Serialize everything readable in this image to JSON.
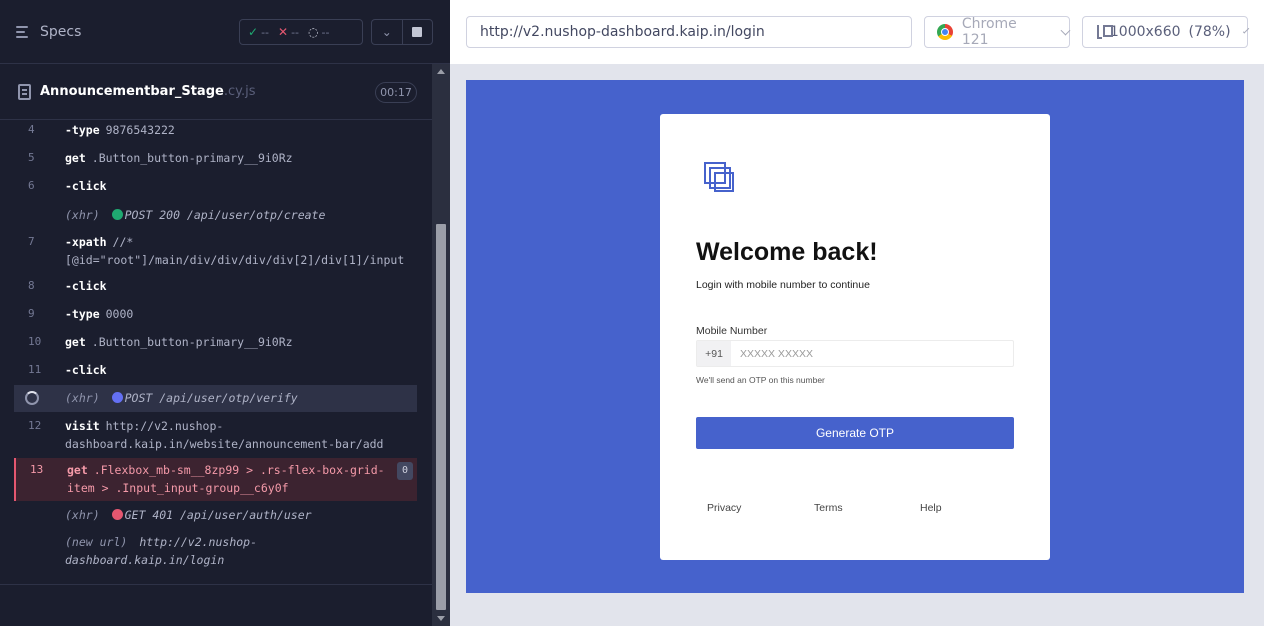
{
  "runner": {
    "specs_label": "Specs",
    "stats": {
      "passed": "--",
      "failed": "--",
      "pending": "--"
    },
    "spec_name": "Announcementbar_Stage",
    "spec_ext": ".cy.js",
    "duration": "00:17"
  },
  "commands": [
    {
      "num": "4",
      "name": "-type",
      "arg": "9876543222"
    },
    {
      "num": "5",
      "name": "get",
      "arg": ".Button_button-primary__9i0Rz"
    },
    {
      "num": "6",
      "name": "-click",
      "arg": ""
    },
    {
      "num": "",
      "xhr": "(xhr)",
      "status_color": "#1fa971",
      "req": "POST 200 /api/user/otp/create"
    },
    {
      "num": "7",
      "name": "-xpath",
      "arg": "//*[@id=\"root\"]/main/div/div/div/div[2]/div[1]/input"
    },
    {
      "num": "8",
      "name": "-click",
      "arg": ""
    },
    {
      "num": "9",
      "name": "-type",
      "arg": "0000"
    },
    {
      "num": "10",
      "name": "get",
      "arg": ".Button_button-primary__9i0Rz"
    },
    {
      "num": "11",
      "name": "-click",
      "arg": ""
    },
    {
      "num": "",
      "xhr": "(xhr)",
      "status_color": "#6470f3",
      "req": "POST /api/user/otp/verify"
    },
    {
      "num": "12",
      "name": "visit",
      "arg": "http://v2.nushop-dashboard.kaip.in/website/announcement-bar/add"
    },
    {
      "num": "13",
      "name": "get",
      "arg": ".Flexbox_mb-sm__8zp99 > .rs-flex-box-grid-item > .Input_input-group__c6y0f",
      "badge": "0"
    },
    {
      "num": "",
      "xhr": "(xhr)",
      "status_color": "#e45770",
      "req": "GET 401 /api/user/auth/user"
    },
    {
      "num": "",
      "xhr": "(new url)",
      "req": "http://v2.nushop-dashboard.kaip.in/login"
    }
  ],
  "browser_bar": {
    "url": "http://v2.nushop-dashboard.kaip.in/login",
    "browser": "Chrome 121",
    "viewport": "1000x660",
    "scale": "(78%)"
  },
  "login": {
    "title": "Welcome back!",
    "subtitle": "Login with mobile number to continue",
    "mobile_label": "Mobile Number",
    "country_code": "+91",
    "placeholder": "XXXXX XXXXX",
    "hint": "We'll send an OTP on this number",
    "button": "Generate OTP",
    "footer": [
      "Privacy",
      "Terms",
      "Help"
    ]
  },
  "colors": {
    "accent": "#4662cc",
    "runner_bg": "#1b1e2e",
    "fail": "#e45770",
    "pass": "#1fa971"
  }
}
